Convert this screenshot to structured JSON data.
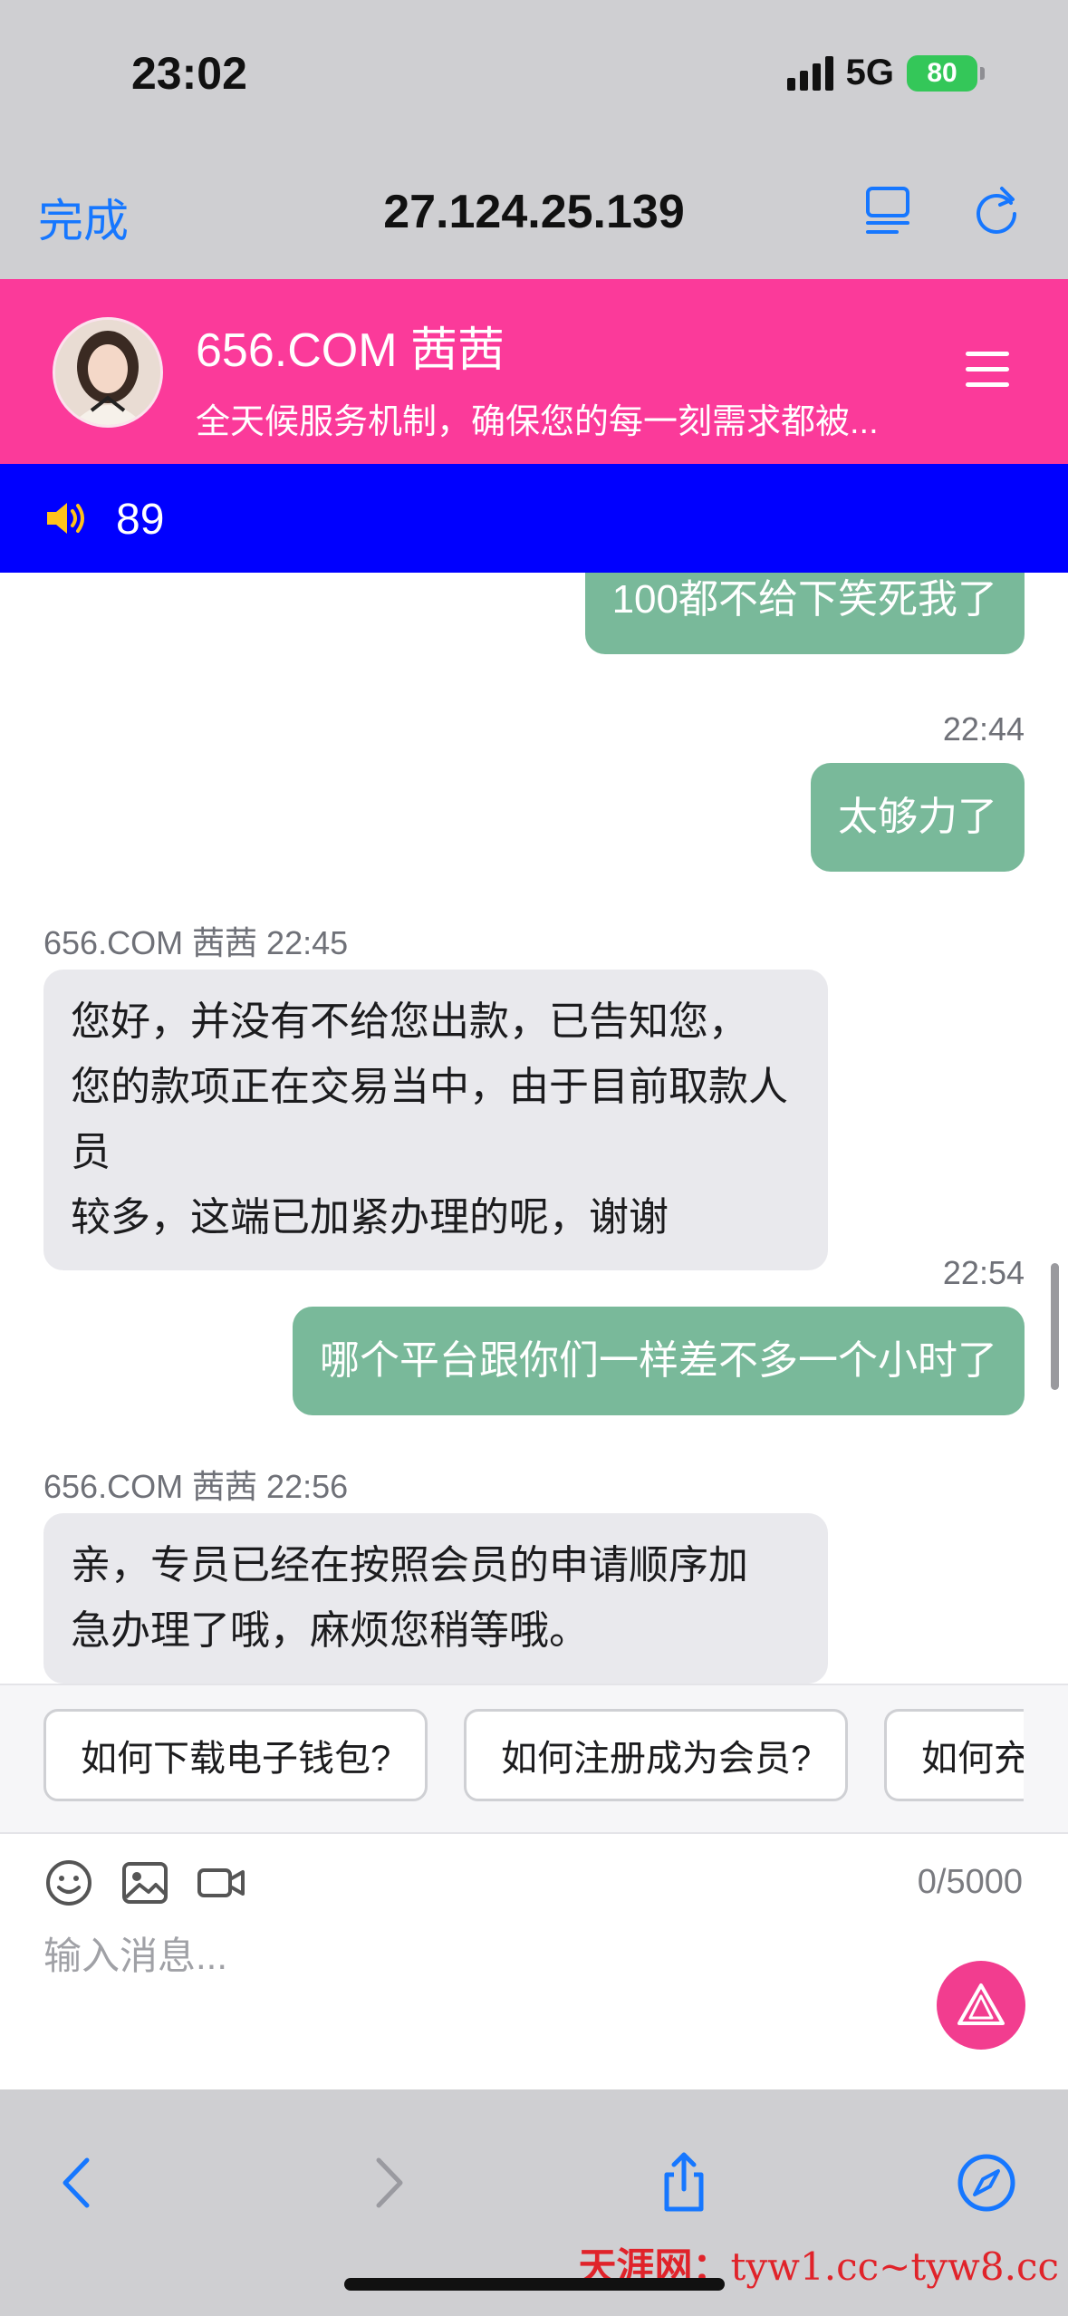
{
  "status_bar": {
    "time": "23:02",
    "network": "5G",
    "battery": "80"
  },
  "browser": {
    "done_label": "完成",
    "url": "27.124.25.139"
  },
  "header": {
    "agent_name": "656.COM 茜茜",
    "subtitle": "全天候服务机制，确保您的每一刻需求都被..."
  },
  "notice": {
    "count": "89"
  },
  "messages": [
    {
      "side": "out",
      "text": "100都不给下笑死我了"
    },
    {
      "side": "out",
      "time": "22:44",
      "text": "太够力了"
    },
    {
      "side": "in",
      "sender": "656.COM 茜茜 22:45",
      "lines": [
        "您好，并没有不给您出款，已告知您，",
        "您的款项正在交易当中，由于目前取款人员",
        "较多，这端已加紧办理的呢，谢谢"
      ]
    },
    {
      "side": "out",
      "time": "22:54",
      "text": "哪个平台跟你们一样差不多一个小时了"
    },
    {
      "side": "in",
      "sender": "656.COM 茜茜 22:56",
      "lines": [
        "亲，专员已经在按照会员的申请顺序加",
        "急办理了哦，麻烦您稍等哦。"
      ]
    }
  ],
  "quick_questions": [
    "如何下载电子钱包?",
    "如何注册成为会员?",
    "如何充"
  ],
  "composer": {
    "counter": "0/5000",
    "placeholder": "输入消息..."
  },
  "watermark": {
    "brand": "天涯网：",
    "url": "tyw1.cc~tyw8.cc"
  },
  "colors": {
    "header": "#fb3a9a",
    "notice": "#0000ff",
    "outgoing": "#79b99a",
    "incoming": "#e9e9ed",
    "send": "#f23d8f",
    "link": "#1677ff"
  }
}
